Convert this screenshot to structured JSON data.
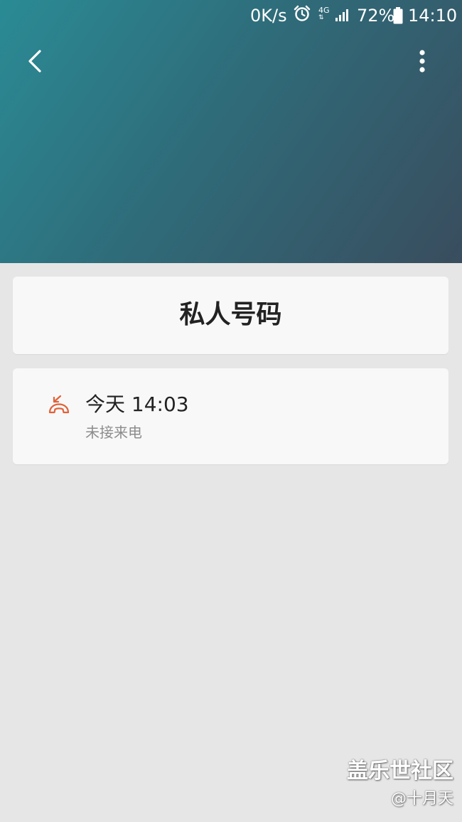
{
  "status_bar": {
    "net_speed": "0K/s",
    "alarm_icon": "alarm-clock-icon",
    "network_type": "4G",
    "signal_icon": "signal-strength-icon",
    "battery_percent": "72%",
    "battery_icon": "battery-icon",
    "time": "14:10"
  },
  "toolbar": {
    "back_icon": "chevron-left-icon",
    "more_icon": "more-vertical-icon"
  },
  "contact": {
    "name": "私人号码"
  },
  "call_log": [
    {
      "icon": "missed-call-icon",
      "time": "今天 14:03",
      "type": "未接来电"
    }
  ],
  "colors": {
    "header_gradient_start": "#2a8b95",
    "header_gradient_end": "#394d5e",
    "background": "#e6e6e6",
    "card": "#f8f8f8",
    "missed_call": "#e0623a"
  },
  "watermark": {
    "brand": "盖乐世社区",
    "user": "@十月天"
  }
}
